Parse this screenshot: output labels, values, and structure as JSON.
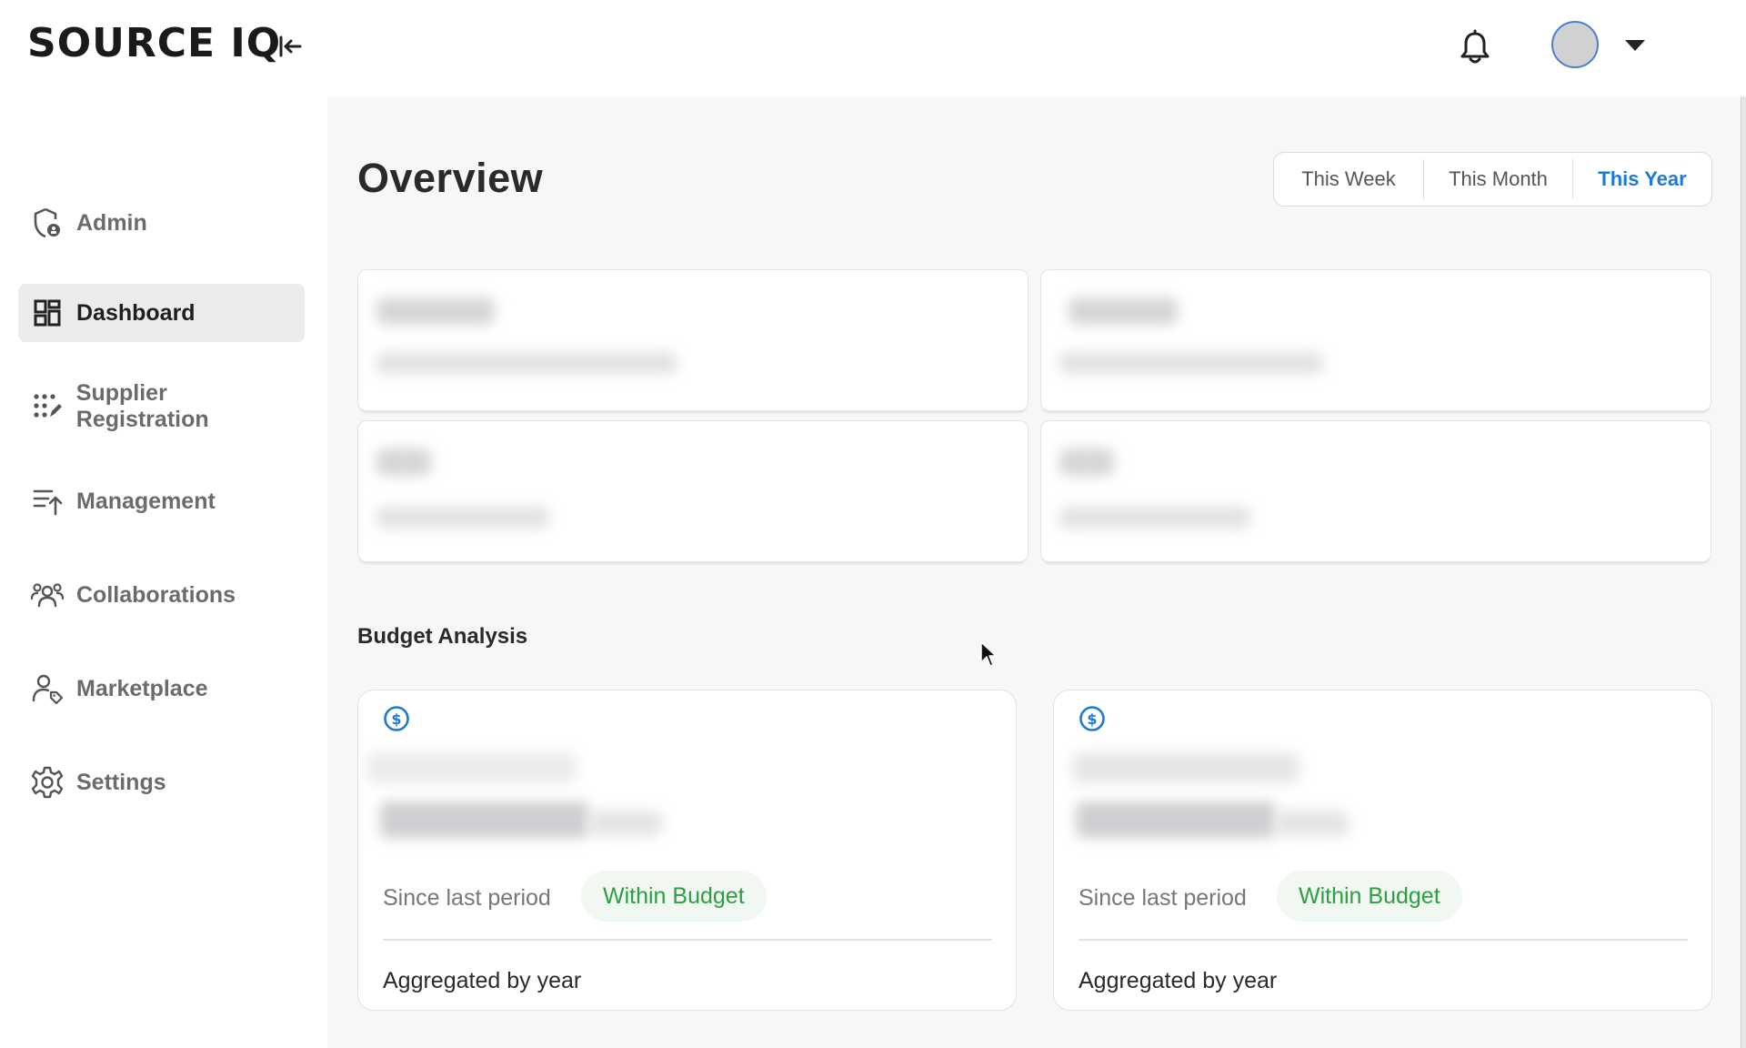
{
  "app": {
    "logo": "SOURCE IQ"
  },
  "sidebar": {
    "items": [
      {
        "label": "Admin",
        "icon": "shield-lock-icon",
        "active": false
      },
      {
        "label": "Dashboard",
        "icon": "dashboard-grid-icon",
        "active": true
      },
      {
        "label": "Supplier Registration",
        "icon": "dots-edit-icon",
        "active": false
      },
      {
        "label": "Management",
        "icon": "sort-list-up-icon",
        "active": false
      },
      {
        "label": "Collaborations",
        "icon": "people-group-icon",
        "active": false
      },
      {
        "label": "Marketplace",
        "icon": "user-tag-icon",
        "active": false
      },
      {
        "label": "Settings",
        "icon": "gear-icon",
        "active": false
      }
    ]
  },
  "header": {
    "icons": [
      "collapse-sidebar-icon",
      "bell-icon",
      "avatar",
      "chevron-down-icon"
    ]
  },
  "overview": {
    "title": "Overview",
    "periods": [
      "This Week",
      "This Month",
      "This Year"
    ],
    "selected_period": "This Year"
  },
  "budget": {
    "title": "Budget Analysis",
    "cards": [
      {
        "icon": "dollar-circle-icon",
        "since_label": "Since last period",
        "status": "Within Budget",
        "footer": "Aggregated by year"
      },
      {
        "icon": "dollar-circle-icon",
        "since_label": "Since last period",
        "status": "Within Budget",
        "footer": "Aggregated by year"
      }
    ]
  },
  "colors": {
    "accent": "#1f7ad1",
    "success_text": "#2e9e44",
    "success_bg": "#f1f8f1",
    "active_nav_bg": "#ececee"
  }
}
